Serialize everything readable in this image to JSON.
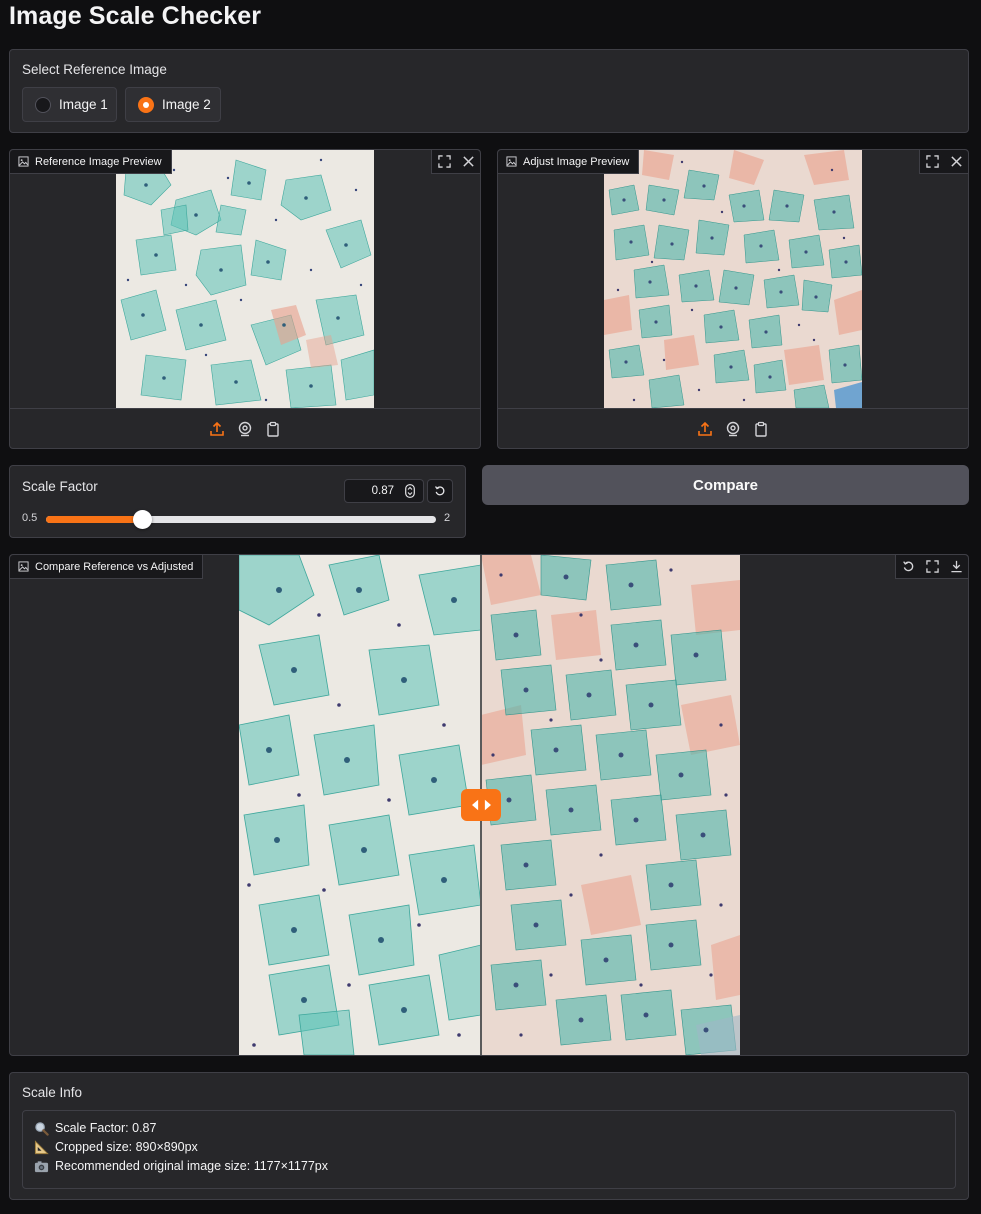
{
  "app_title": "Image Scale Checker",
  "reference_selector": {
    "label": "Select Reference Image",
    "options": [
      "Image 1",
      "Image 2"
    ],
    "selected": "Image 2"
  },
  "reference_preview": {
    "label": "Reference Image Preview"
  },
  "adjust_preview": {
    "label": "Adjust Image Preview"
  },
  "scale": {
    "label": "Scale Factor",
    "value": "0.87",
    "min_label": "0.5",
    "max_label": "2",
    "fill_fraction": 0.2467
  },
  "compare_button": {
    "label": "Compare"
  },
  "compare_view": {
    "label": "Compare Reference vs Adjusted"
  },
  "scale_info": {
    "label": "Scale Info",
    "lines": [
      {
        "icon": "magnifier-icon",
        "text": "Scale Factor: 0.87"
      },
      {
        "icon": "triangular-ruler-icon",
        "text": "Cropped size: 890×890px"
      },
      {
        "icon": "camera-icon",
        "text": "Recommended original image size: 1177×1177px"
      }
    ]
  },
  "colors": {
    "accent": "#f97316",
    "background": "#0f0f11",
    "panel": "#27272a",
    "cell_teal": "#4fb7ad",
    "cell_salmon": "#e9a08c"
  }
}
